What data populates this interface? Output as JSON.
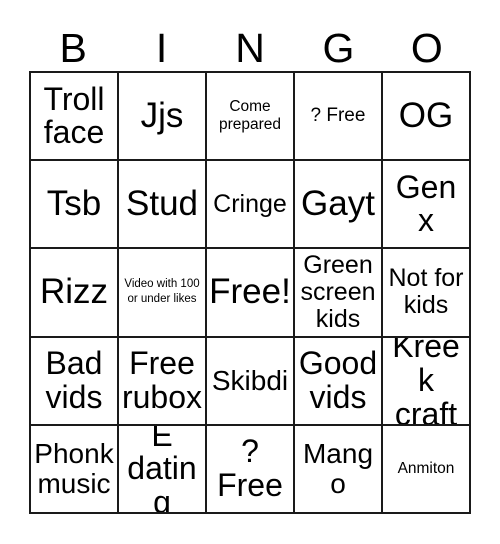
{
  "card": {
    "title": "BINGO",
    "headers": [
      "B",
      "I",
      "N",
      "G",
      "O"
    ],
    "columns": 5,
    "rows": 5,
    "colors": {
      "background": "#ffffff",
      "border": "#1a1a1a",
      "text": "#000000"
    },
    "cells": [
      {
        "text": "Troll face",
        "size": "xxl",
        "row": 1,
        "col": 1,
        "column_letter": "B",
        "free_space": false
      },
      {
        "text": "Jjs",
        "size": "huge",
        "row": 1,
        "col": 2,
        "column_letter": "I",
        "free_space": false
      },
      {
        "text": "Come prepared",
        "size": "sm",
        "row": 1,
        "col": 3,
        "column_letter": "N",
        "free_space": false
      },
      {
        "text": "? Free",
        "size": "md",
        "row": 1,
        "col": 4,
        "column_letter": "G",
        "free_space": true
      },
      {
        "text": "OG",
        "size": "huge",
        "row": 1,
        "col": 5,
        "column_letter": "O",
        "free_space": false
      },
      {
        "text": "Tsb",
        "size": "huge",
        "row": 2,
        "col": 1,
        "column_letter": "B",
        "free_space": false
      },
      {
        "text": "Stud",
        "size": "huge",
        "row": 2,
        "col": 2,
        "column_letter": "I",
        "free_space": false
      },
      {
        "text": "Cringe",
        "size": "lg",
        "row": 2,
        "col": 3,
        "column_letter": "N",
        "free_space": false
      },
      {
        "text": "Gayt",
        "size": "huge",
        "row": 2,
        "col": 4,
        "column_letter": "G",
        "free_space": false
      },
      {
        "text": "Gen x",
        "size": "xxl",
        "row": 2,
        "col": 5,
        "column_letter": "O",
        "free_space": false
      },
      {
        "text": "Rizz",
        "size": "huge",
        "row": 3,
        "col": 1,
        "column_letter": "B",
        "free_space": false
      },
      {
        "text": "Video with 100 or under likes",
        "size": "xs",
        "row": 3,
        "col": 2,
        "column_letter": "I",
        "free_space": false
      },
      {
        "text": "Free!",
        "size": "huge",
        "row": 3,
        "col": 3,
        "column_letter": "N",
        "free_space": true
      },
      {
        "text": "Green screen kids",
        "size": "lg",
        "row": 3,
        "col": 4,
        "column_letter": "G",
        "free_space": false
      },
      {
        "text": "Not for kids",
        "size": "lg",
        "row": 3,
        "col": 5,
        "column_letter": "O",
        "free_space": false
      },
      {
        "text": "Bad vids",
        "size": "xxl",
        "row": 4,
        "col": 1,
        "column_letter": "B",
        "free_space": false
      },
      {
        "text": "Free rubox",
        "size": "xxl",
        "row": 4,
        "col": 2,
        "column_letter": "I",
        "free_space": false
      },
      {
        "text": "Skibdi",
        "size": "xl",
        "row": 4,
        "col": 3,
        "column_letter": "N",
        "free_space": false
      },
      {
        "text": "Good vids",
        "size": "xxl",
        "row": 4,
        "col": 4,
        "column_letter": "G",
        "free_space": false
      },
      {
        "text": "Kreek craft",
        "size": "xxl",
        "row": 4,
        "col": 5,
        "column_letter": "O",
        "free_space": false
      },
      {
        "text": "Phonk music",
        "size": "xl",
        "row": 5,
        "col": 1,
        "column_letter": "B",
        "free_space": false
      },
      {
        "text": "E dating",
        "size": "xxl",
        "row": 5,
        "col": 2,
        "column_letter": "I",
        "free_space": false
      },
      {
        "text": "? Free",
        "size": "xxl",
        "row": 5,
        "col": 3,
        "column_letter": "N",
        "free_space": true
      },
      {
        "text": "Mango",
        "size": "xl",
        "row": 5,
        "col": 4,
        "column_letter": "G",
        "free_space": false
      },
      {
        "text": "Anmiton",
        "size": "sm",
        "row": 5,
        "col": 5,
        "column_letter": "O",
        "free_space": false
      }
    ]
  }
}
